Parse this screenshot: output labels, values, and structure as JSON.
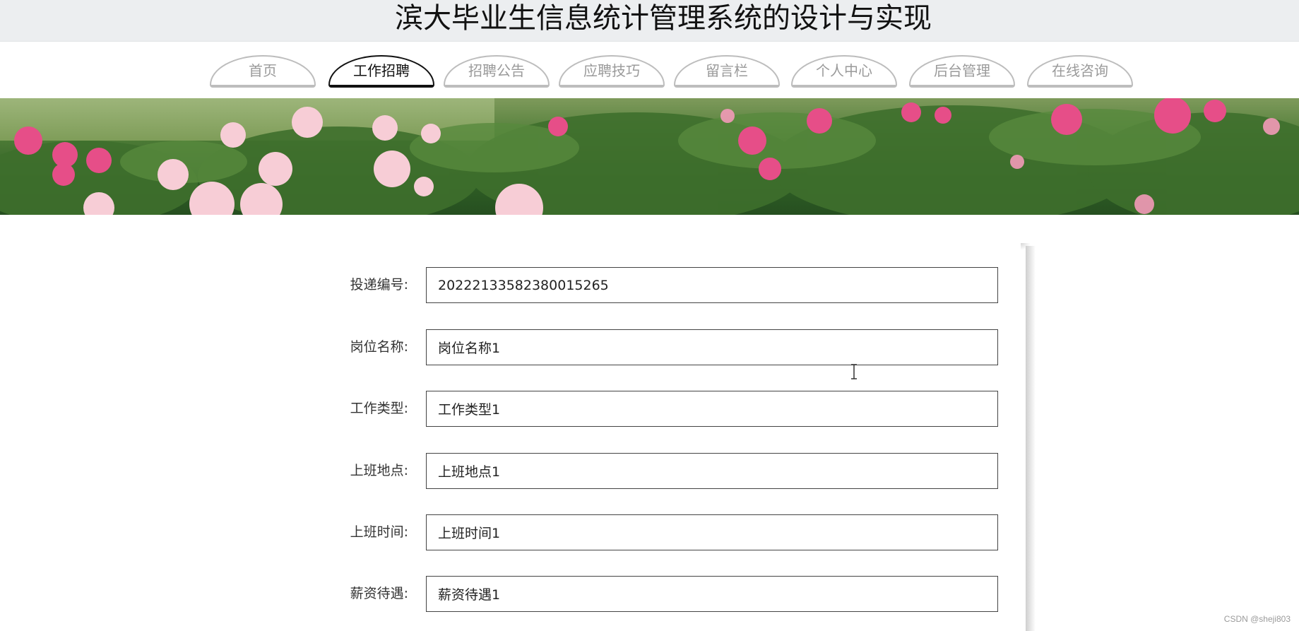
{
  "header": {
    "title": "滨大毕业生信息统计管理系统的设计与实现"
  },
  "nav": {
    "items": [
      {
        "label": "首页",
        "active": false
      },
      {
        "label": "工作招聘",
        "active": true
      },
      {
        "label": "招聘公告",
        "active": false
      },
      {
        "label": "应聘技巧",
        "active": false
      },
      {
        "label": "留言栏",
        "active": false
      },
      {
        "label": "个人中心",
        "active": false
      },
      {
        "label": "后台管理",
        "active": false
      },
      {
        "label": "在线咨询",
        "active": false
      }
    ]
  },
  "form": {
    "fields": [
      {
        "label": "投递编号:",
        "value": "20222133582380015265"
      },
      {
        "label": "岗位名称:",
        "value": "岗位名称1"
      },
      {
        "label": "工作类型:",
        "value": "工作类型1"
      },
      {
        "label": "上班地点:",
        "value": "上班地点1"
      },
      {
        "label": "上班时间:",
        "value": "上班时间1"
      },
      {
        "label": "薪资待遇:",
        "value": "薪资待遇1"
      }
    ]
  },
  "watermark": "CSDN @sheji803",
  "colors": {
    "title_bar": "#eceef0",
    "nav_active": "#111111",
    "nav_inactive": "#9a9a9a"
  }
}
